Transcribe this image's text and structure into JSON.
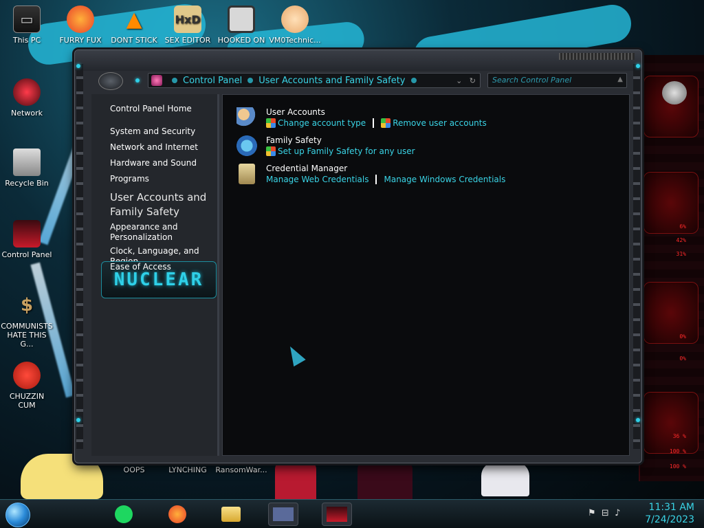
{
  "desktop_icons": [
    {
      "label": "This PC"
    },
    {
      "label": "FURRY FUX"
    },
    {
      "label": "DONT STICK"
    },
    {
      "label": "SEX EDITOR"
    },
    {
      "label": "HOOKED ON"
    },
    {
      "label": "VM0Technic..."
    },
    {
      "label": "Network"
    },
    {
      "label": "Recycle Bin"
    },
    {
      "label": "Control Panel"
    },
    {
      "label": "COMMUNISTS HATE THIS G..."
    },
    {
      "label": "CHUZZIN CUM"
    },
    {
      "label": "OOPS"
    },
    {
      "label": "LYNCHING"
    },
    {
      "label": "RansomWar..."
    }
  ],
  "window": {
    "breadcrumb": [
      "Control Panel",
      "User Accounts and Family Safety"
    ],
    "search_placeholder": "Search Control Panel",
    "sidebar": {
      "home": "Control Panel Home",
      "items": [
        "System and Security",
        "Network and Internet",
        "Hardware and Sound",
        "Programs",
        "User Accounts and Family Safety",
        "Appearance and Personalization",
        "Clock, Language, and Region",
        "Ease of Access"
      ],
      "banner": "NUCLEAR"
    },
    "groups": [
      {
        "title": "User Accounts",
        "links": [
          "Change account type",
          "Remove user accounts"
        ]
      },
      {
        "title": "Family Safety",
        "links": [
          "Set up Family Safety for any user"
        ]
      },
      {
        "title": "Credential Manager",
        "links": [
          "Manage Web Credentials",
          "Manage Windows Credentials"
        ]
      }
    ]
  },
  "hud": {
    "values": [
      "6%",
      "42%",
      "31%",
      "0%",
      "0%",
      "36 %",
      "100 %",
      "100 %"
    ]
  },
  "taskbar": {
    "time": "11:31 AM",
    "date": "7/24/2023"
  },
  "colors": {
    "accent": "#3ad4e6",
    "hud_red": "#ff2a2a"
  }
}
